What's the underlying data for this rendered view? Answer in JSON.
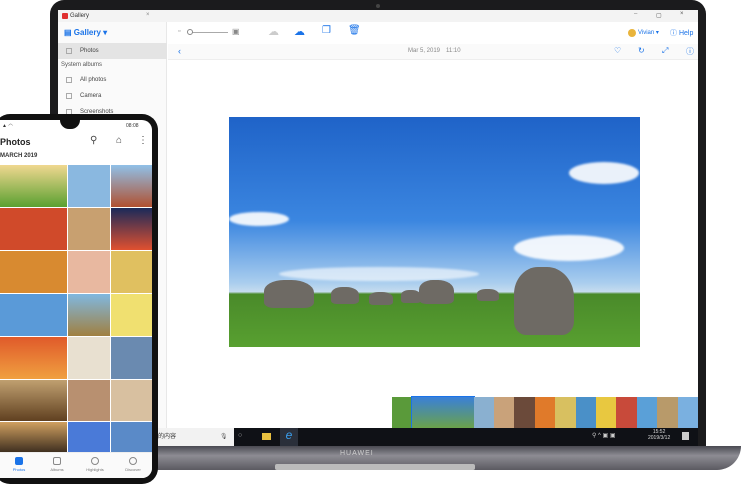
{
  "laptop": {
    "brand": "HUAWEI",
    "window": {
      "tab_title": "Gallery",
      "app_name": "Gallery",
      "sidebar": {
        "items": [
          {
            "label": "Photos"
          }
        ],
        "section": "System albums",
        "albums": [
          {
            "label": "All photos"
          },
          {
            "label": "Camera"
          },
          {
            "label": "Screenshots"
          }
        ]
      },
      "user": "Vivian",
      "help": "Help",
      "photo_date": "Mar 5, 2019",
      "photo_time": "11:10"
    },
    "taskbar": {
      "search_text": "的内容",
      "time": "15:52",
      "date": "2019/3/12"
    }
  },
  "phone": {
    "status_time": "08:08",
    "title": "Photos",
    "section": "MARCH 2019",
    "nav": [
      {
        "label": "Photos",
        "active": true
      },
      {
        "label": "Albums"
      },
      {
        "label": "Highlights"
      },
      {
        "label": "Discover"
      }
    ]
  },
  "colors": {
    "accent": "#1a73e8"
  }
}
